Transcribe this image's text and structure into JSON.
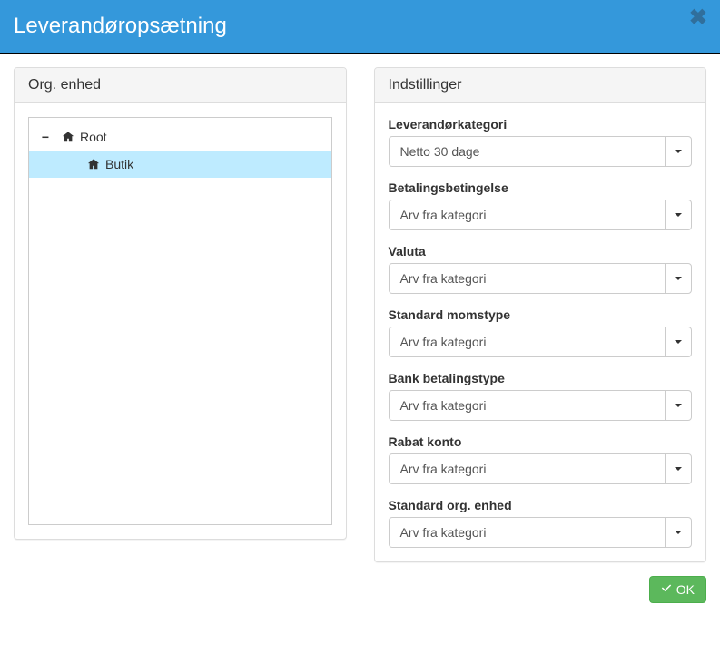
{
  "header": {
    "title": "Leverandøropsætning"
  },
  "panels": {
    "org": {
      "title": "Org. enhed"
    },
    "settings": {
      "title": "Indstillinger"
    }
  },
  "tree": {
    "root": {
      "label": "Root"
    },
    "child": {
      "label": "Butik"
    }
  },
  "settings": {
    "fields": [
      {
        "label": "Leverandørkategori",
        "value": "Netto 30 dage"
      },
      {
        "label": "Betalingsbetingelse",
        "value": "Arv fra kategori"
      },
      {
        "label": "Valuta",
        "value": "Arv fra kategori"
      },
      {
        "label": "Standard momstype",
        "value": "Arv fra kategori"
      },
      {
        "label": "Bank betalingstype",
        "value": "Arv fra kategori"
      },
      {
        "label": "Rabat konto",
        "value": "Arv fra kategori"
      },
      {
        "label": "Standard org. enhed",
        "value": "Arv fra kategori"
      }
    ]
  },
  "footer": {
    "ok": "OK"
  },
  "icons": {
    "close": "✖"
  }
}
